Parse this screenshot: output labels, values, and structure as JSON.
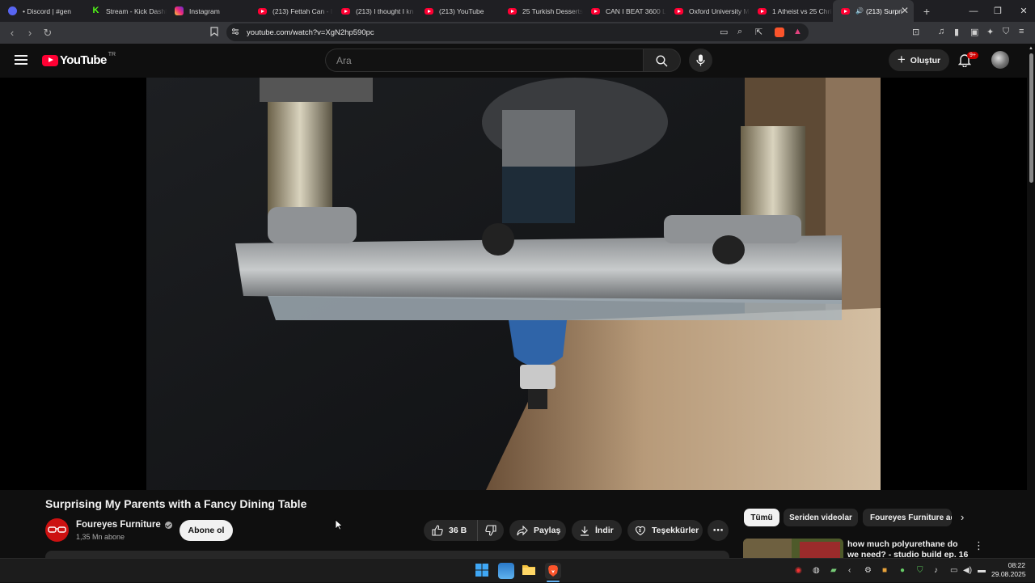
{
  "browser": {
    "tabs": [
      {
        "label": "• Discord | #gen",
        "icon": "discord-icon"
      },
      {
        "label": "Stream - Kick Dashb",
        "icon": "kick-icon"
      },
      {
        "label": "Instagram",
        "icon": "instagram-icon"
      },
      {
        "label": "(213) Fettah Can - I",
        "icon": "youtube-icon"
      },
      {
        "label": "(213) I thought I kn",
        "icon": "youtube-icon"
      },
      {
        "label": "(213) YouTube",
        "icon": "youtube-icon"
      },
      {
        "label": "25 Turkish Desserts",
        "icon": "youtube-icon"
      },
      {
        "label": "CAN I BEAT 3600 LB",
        "icon": "youtube-icon"
      },
      {
        "label": "Oxford University M",
        "icon": "youtube-icon"
      },
      {
        "label": "1 Atheist vs 25 Chri",
        "icon": "youtube-icon"
      },
      {
        "label": "(213) Surpri",
        "icon": "youtube-icon",
        "active": true
      }
    ],
    "url": "youtube.com/watch?v=XgN2hp590pc"
  },
  "youtube": {
    "logo_text": "YouTube",
    "logo_country": "TR",
    "search_placeholder": "Ara",
    "create_label": "Oluştur",
    "notifications_badge": "9+"
  },
  "video": {
    "title": "Surprising My Parents with a Fancy Dining Table",
    "channel_name": "Foureyes Furniture",
    "subscribers": "1,35 Mn abone",
    "subscribe_label": "Abone ol",
    "likes": "36 B",
    "share_label": "Paylaş",
    "download_label": "İndir",
    "thanks_label": "Teşekkürler"
  },
  "sidebar": {
    "chips": [
      "Tümü",
      "Seriden videolar",
      "Foureyes Furniture ad"
    ],
    "recommendation_title": "how much polyurethane do we need? - studio build ep. 16"
  },
  "taskbar": {
    "time": "08:22",
    "date": "29.08.2025"
  },
  "colors": {
    "youtube_red": "#ff0033",
    "background": "#0f0f0f",
    "pill_bg": "#272727"
  }
}
